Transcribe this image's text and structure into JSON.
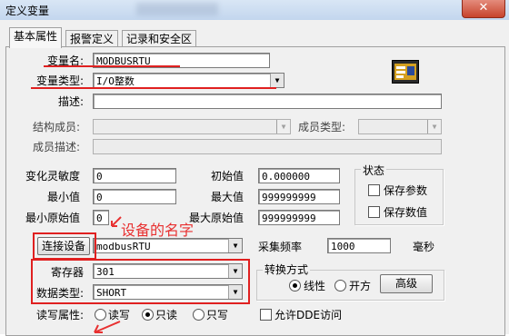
{
  "window": {
    "title": "定义变量",
    "close_symbol": "✕"
  },
  "tabs": [
    {
      "label": "基本属性",
      "active": true
    },
    {
      "label": "报警定义",
      "active": false
    },
    {
      "label": "记录和安全区",
      "active": false
    }
  ],
  "fields": {
    "var_name": {
      "label": "变量名:",
      "value": "MODBUSRTU"
    },
    "var_type": {
      "label": "变量类型:",
      "value": "I/O整数"
    },
    "description": {
      "label": "描述:",
      "value": ""
    },
    "struct_member": {
      "label": "结构成员:",
      "value": ""
    },
    "member_type": {
      "label": "成员类型:",
      "value": ""
    },
    "member_desc": {
      "label": "成员描述:",
      "value": ""
    },
    "sensitivity": {
      "label": "变化灵敏度",
      "value": "0"
    },
    "initial": {
      "label": "初始值",
      "value": "0.000000"
    },
    "min": {
      "label": "最小值",
      "value": "0"
    },
    "max": {
      "label": "最大值",
      "value": "999999999"
    },
    "min_raw": {
      "label": "最小原始值",
      "value": "0"
    },
    "max_raw": {
      "label": "最大原始值",
      "value": "999999999"
    },
    "device": {
      "label": "连接设备",
      "value": "modbusRTU"
    },
    "sample_freq": {
      "label": "采集频率",
      "value": "1000",
      "unit": "毫秒"
    },
    "register": {
      "label": "寄存器",
      "value": "301"
    },
    "data_type": {
      "label": "数据类型:",
      "value": "SHORT"
    },
    "rw": {
      "label": "读写属性:",
      "options": [
        "读写",
        "只读",
        "只写"
      ],
      "selected": "只读"
    }
  },
  "status_group": {
    "title": "状态",
    "save_param": {
      "label": "保存参数",
      "checked": false
    },
    "save_value": {
      "label": "保存数值",
      "checked": false
    }
  },
  "convert_group": {
    "title": "转换方式",
    "options": [
      "线性",
      "开方"
    ],
    "selected": "线性",
    "advanced_label": "高级"
  },
  "allow_dde": {
    "label": "允许DDE访问",
    "checked": false
  },
  "annotation": {
    "text": "设备的名字",
    "color": "#e83030"
  },
  "colors": {
    "annotation_red": "#e02020",
    "dialog_bg": "#f0f0f0"
  }
}
